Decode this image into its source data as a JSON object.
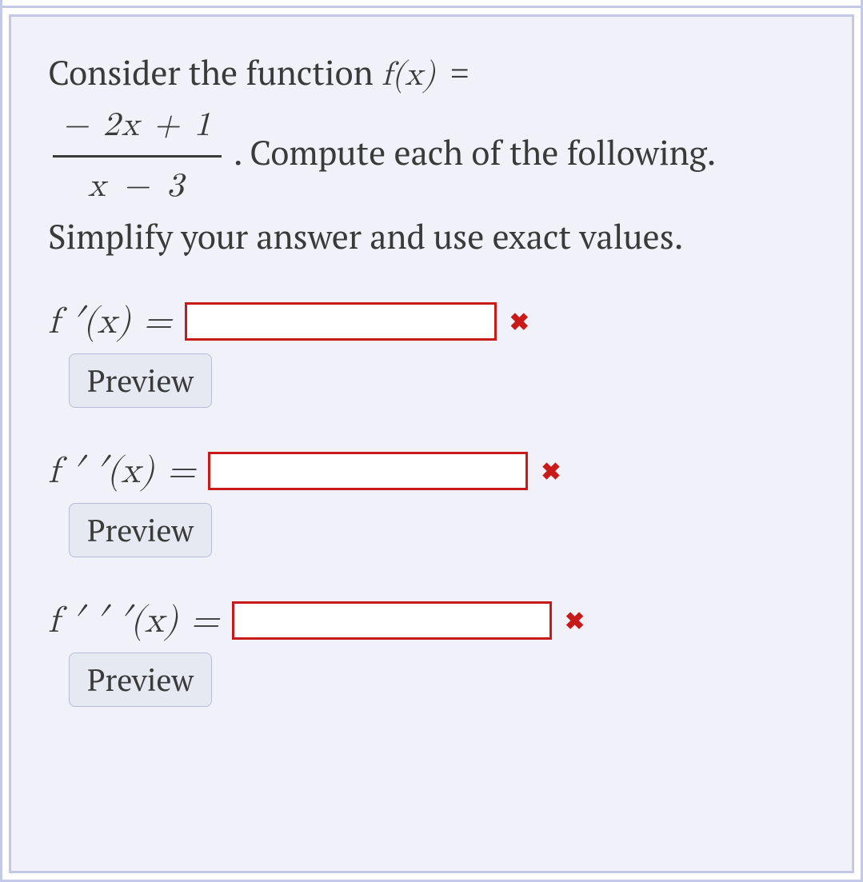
{
  "question": {
    "text_part1": "Consider the function ",
    "function_lhs": "f(x)",
    "equals": "=",
    "fraction_numerator": "− 2x + 1",
    "fraction_denominator": "x − 3",
    "text_part2": ". Compute each of the following. Simplify your answer and use exact values."
  },
  "rows": [
    {
      "label": "f ′(x) =",
      "value": "",
      "status": "incorrect",
      "preview_label": "Preview"
    },
    {
      "label": "f ′ ′(x) =",
      "value": "",
      "status": "incorrect",
      "preview_label": "Preview"
    },
    {
      "label": "f ′ ′ ′(x) =",
      "value": "",
      "status": "incorrect",
      "preview_label": "Preview"
    }
  ],
  "icons": {
    "incorrect": "✖"
  }
}
